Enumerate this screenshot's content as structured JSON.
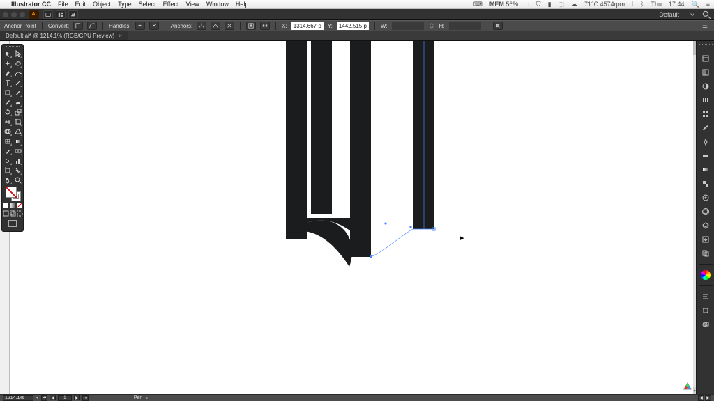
{
  "mac": {
    "app_name": "Illustrator CC",
    "menus": [
      "File",
      "Edit",
      "Object",
      "Type",
      "Select",
      "Effect",
      "View",
      "Window",
      "Help"
    ],
    "status_temp": "71°C 4574rpm",
    "status_day": "Thu",
    "status_time": "17:44",
    "mem_label": "MEM",
    "mem_pct": "56%"
  },
  "titlebar": {
    "workspace_label": "Default",
    "app_badge": "Ai"
  },
  "controlbar": {
    "anchor_label": "Anchor Point",
    "convert_label": "Convert:",
    "handles_label": "Handles:",
    "anchors_label": "Anchors:",
    "x_label": "X:",
    "y_label": "Y:",
    "x_value": "1314.667 p",
    "y_value": "1442.515 p",
    "w_label": "W:",
    "h_label": "H:",
    "w_value": "",
    "h_value": ""
  },
  "doc_tab": {
    "label": "Default.ai* @ 1214.1% (RGB/GPU Preview)"
  },
  "bottom": {
    "zoom": "1214.1%",
    "page": "1",
    "info": "Pen"
  },
  "tools": {
    "left": [
      "selection",
      "direct-selection",
      "magic-wand",
      "lasso",
      "pen",
      "curvature",
      "type",
      "line",
      "rectangle",
      "paintbrush",
      "pencil",
      "eraser",
      "rotate",
      "scale",
      "width",
      "free-transform",
      "shape-builder",
      "perspective",
      "mesh",
      "gradient",
      "eyedropper",
      "blend",
      "symbol-sprayer",
      "column-graph",
      "artboard",
      "slice",
      "hand",
      "zoom"
    ],
    "modes": [
      "color",
      "gradient",
      "none"
    ],
    "draw": [
      "normal",
      "behind",
      "inside"
    ]
  },
  "right_panel": {
    "icons": [
      "properties",
      "libraries",
      "color",
      "color-guide",
      "swatches",
      "brushes",
      "symbols",
      "stroke",
      "gradient",
      "transparency",
      "appearance",
      "graphic-styles",
      "layers",
      "asset-export",
      "artboards",
      "gap",
      "color-wheel",
      "gap",
      "align",
      "transform",
      "pathfinder"
    ]
  },
  "chart_data": {
    "type": "other",
    "note": "Vector glyph artwork on artboard (pen-tool editing)",
    "anchor_point": {
      "x": 1314.667,
      "y": 1442.515
    },
    "zoom_pct": 1214.1
  }
}
